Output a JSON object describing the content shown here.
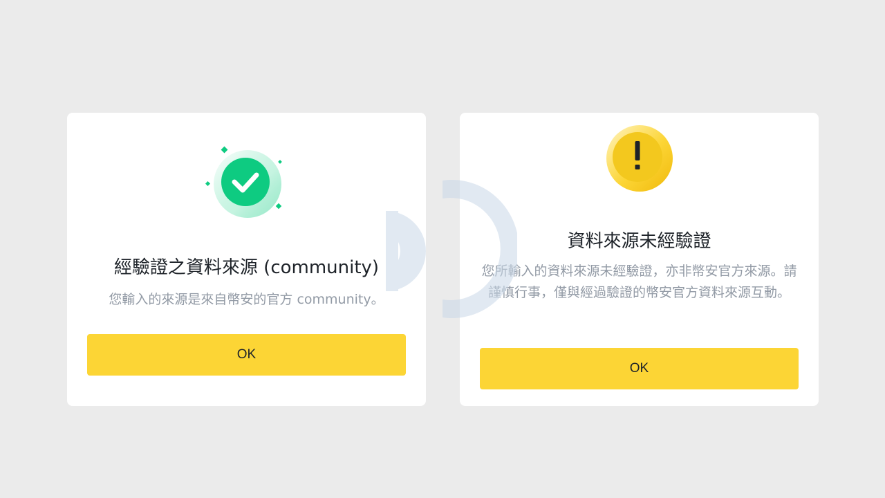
{
  "dialog_verified": {
    "icon": "check-circle-icon",
    "title": "經驗證之資料來源 (community)",
    "description": "您輸入的來源是來自幣安的官方 community。",
    "ok_label": "OK"
  },
  "dialog_unverified": {
    "icon": "warning-exclamation-icon",
    "title": "資料來源未經驗證",
    "description": "您所輸入的資料來源未經驗證，亦非幣安官方來源。請謹慎行事，僅與經過驗證的幣安官方資料來源互動。",
    "ok_label": "OK"
  },
  "colors": {
    "background": "#ebebeb",
    "card": "#ffffff",
    "button": "#fcd535",
    "success_green": "#0ecb81",
    "warning_yellow": "#f0b90b",
    "title_text": "#1e2329",
    "muted_text": "#929aa5"
  }
}
